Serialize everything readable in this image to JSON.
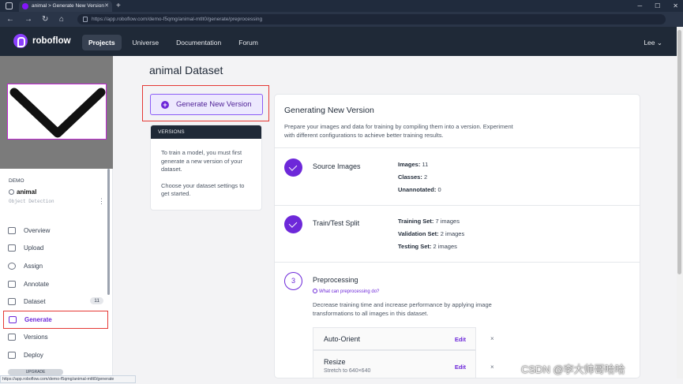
{
  "browser": {
    "tab_title": "animal > Generate New Version",
    "url": "https://app.roboflow.com/demo-f5qmg/animal-mtlt0/generate/preprocessing",
    "status_url": "https://app.roboflow.com/demo-f5qmg/animal-mtlt0/generate"
  },
  "appnav": {
    "brand": "roboflow",
    "links": [
      {
        "label": "Projects",
        "active": true
      },
      {
        "label": "Universe",
        "active": false
      },
      {
        "label": "Documentation",
        "active": false
      },
      {
        "label": "Forum",
        "active": false
      }
    ],
    "user": "Lee"
  },
  "sidebar": {
    "workspace": "DEMO",
    "project_name": "animal",
    "project_type": "Object Detection",
    "items": [
      {
        "label": "Overview",
        "icon": "overview-icon"
      },
      {
        "label": "Upload",
        "icon": "upload-icon"
      },
      {
        "label": "Assign",
        "icon": "assign-icon"
      },
      {
        "label": "Annotate",
        "icon": "annotate-icon"
      },
      {
        "label": "Dataset",
        "icon": "dataset-icon",
        "badge": "11"
      },
      {
        "label": "Generate",
        "icon": "generate-icon",
        "active": true
      },
      {
        "label": "Versions",
        "icon": "versions-icon"
      },
      {
        "label": "Deploy",
        "icon": "deploy-icon"
      }
    ],
    "upgrade": "UPGRADE"
  },
  "main": {
    "title": "animal Dataset",
    "generate_button": "Generate New Version",
    "versions": {
      "header": "VERSIONS",
      "text1": "To train a model, you must first generate a new version of your dataset.",
      "text2": "Choose your dataset settings to get started."
    },
    "card": {
      "title": "Generating New Version",
      "description": "Prepare your images and data for training by compiling them into a version. Experiment with different configurations to achieve better training results.",
      "source": {
        "title": "Source Images",
        "images_label": "Images:",
        "images_value": "11",
        "classes_label": "Classes:",
        "classes_value": "2",
        "unannotated_label": "Unannotated:",
        "unannotated_value": "0"
      },
      "split": {
        "title": "Train/Test Split",
        "train_label": "Training Set:",
        "train_value": "7 images",
        "valid_label": "Validation Set:",
        "valid_value": "2 images",
        "test_label": "Testing Set:",
        "test_value": "2 images"
      },
      "preprocessing": {
        "step": "3",
        "title": "Preprocessing",
        "help": "What can preprocessing do?",
        "description": "Decrease training time and increase performance by applying image transformations to all images in this dataset.",
        "options": [
          {
            "name": "Auto-Orient",
            "sub": "",
            "edit": "Edit",
            "remove": "×"
          },
          {
            "name": "Resize",
            "sub": "Stretch to 640×640",
            "edit": "Edit",
            "remove": "×"
          }
        ]
      }
    }
  },
  "watermark": "CSDN @李大帅哥哈哈",
  "colors": {
    "accent": "#6d28d9",
    "nav_bg": "#1f2937",
    "highlight": "#e53935"
  }
}
